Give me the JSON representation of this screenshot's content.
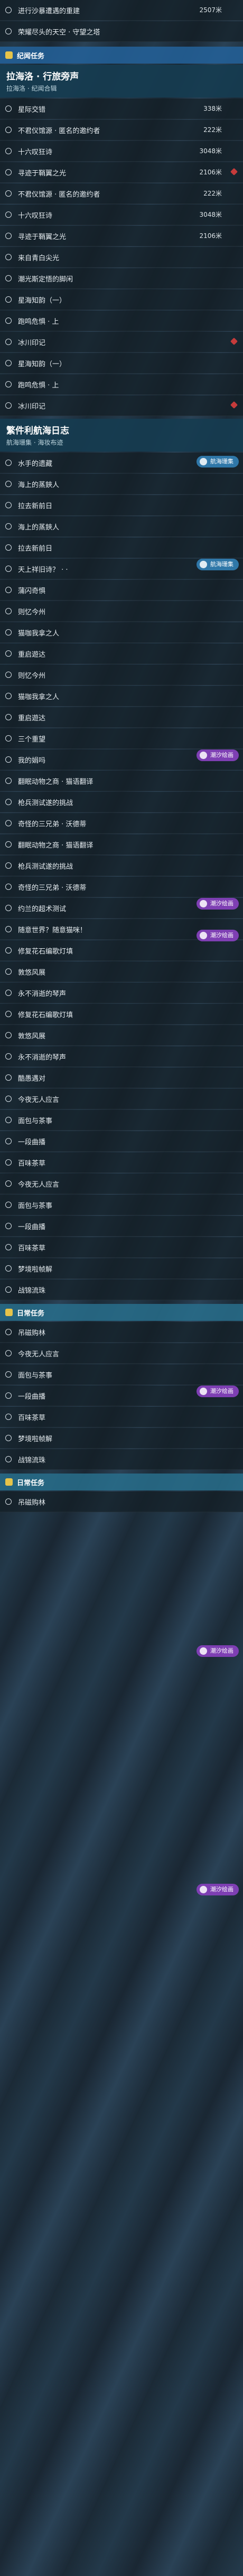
{
  "rows_top": [
    {
      "label": "进行沙暴遭遇的重建",
      "dist": "2507米"
    },
    {
      "label": "荣耀尽头的天空 · 守望之塔",
      "dist": ""
    }
  ],
  "section1": {
    "label": "纪闻任务"
  },
  "header1": {
    "title": "拉海洛 · 行旅旁声",
    "subtitle": "拉海洛 · 纪闻合辑"
  },
  "rows_a": [
    {
      "label": "星际交错",
      "dist": "338米"
    },
    {
      "label": "不君仪馆源 · 匿名的邀约者",
      "dist": "222米"
    },
    {
      "label": "十六叹狂诗",
      "dist": "3048米"
    },
    {
      "label": "寻迹于鞘翼之光",
      "dist": "2106米",
      "flag": true
    },
    {
      "label": "不君仪馆源 · 匿名的邀约者",
      "dist": "222米"
    },
    {
      "label": "十六叹狂诗",
      "dist": "3048米"
    },
    {
      "label": "寻迹于鞘翼之光",
      "dist": "2106米"
    },
    {
      "label": "来自青白尖光",
      "dist": ""
    },
    {
      "label": "潮光斯定悟的脚闲",
      "dist": ""
    },
    {
      "label": "星海知韵（一）",
      "dist": ""
    },
    {
      "label": "跑鸣危惧 · 上",
      "dist": ""
    },
    {
      "label": "冰川印记",
      "dist": "",
      "flag": true
    },
    {
      "label": "星海知韵（一）",
      "dist": ""
    },
    {
      "label": "跑鸣危惧 · 上",
      "dist": ""
    },
    {
      "label": "冰川印记",
      "dist": "",
      "flag": true
    }
  ],
  "header2": {
    "title": "繁件利航海日志",
    "subtitle": "航海珊集 · 海妆布迹"
  },
  "badges": {
    "blue": "航海珊集",
    "purple": "潮汐绘画"
  },
  "rows_b": [
    {
      "label": "水手的遗藏",
      "dist": ""
    },
    {
      "label": "海上的蒸鋏人",
      "dist": ""
    },
    {
      "label": "拉去新前日",
      "dist": ""
    },
    {
      "label": "海上的蒸鋏人",
      "dist": ""
    },
    {
      "label": "拉去新前日",
      "dist": ""
    },
    {
      "label": "天上祥旧诗？ · ·",
      "dist": ""
    },
    {
      "label": "蒲闪奇惧",
      "dist": ""
    },
    {
      "label": "则忆今州",
      "dist": ""
    },
    {
      "label": "猫咖我拿之人",
      "dist": ""
    },
    {
      "label": "重启遊达",
      "dist": ""
    },
    {
      "label": "则忆今州",
      "dist": ""
    },
    {
      "label": "猫咖我拿之人",
      "dist": ""
    },
    {
      "label": "重启遊达",
      "dist": ""
    },
    {
      "label": "三个重望",
      "dist": ""
    },
    {
      "label": "我的娟吗",
      "dist": ""
    },
    {
      "label": "翻眠动物之商 · 猫语翻译",
      "dist": ""
    },
    {
      "label": "枪兵测试遂的挑战",
      "dist": ""
    },
    {
      "label": "奇怪的三兄弟 · 沃德蒂",
      "dist": ""
    },
    {
      "label": "翻眠动物之商 · 猫语翻译",
      "dist": ""
    },
    {
      "label": "枪兵测试遂的挑战",
      "dist": ""
    },
    {
      "label": "奇怪的三兄弟 · 沃德蒂",
      "dist": ""
    },
    {
      "label": "约兰的超术测试",
      "dist": ""
    },
    {
      "label": "随意世界？随意猫咪！",
      "dist": ""
    },
    {
      "label": "修复花石编歌灯填",
      "dist": ""
    },
    {
      "label": "敦悠风展",
      "dist": ""
    },
    {
      "label": "永不消逝的琴声",
      "dist": ""
    },
    {
      "label": "修复花石编歌灯填",
      "dist": ""
    },
    {
      "label": "敦悠风展",
      "dist": ""
    },
    {
      "label": "永不消逝的琴声",
      "dist": ""
    },
    {
      "label": "酷愚遇对",
      "dist": ""
    },
    {
      "label": "今夜无人应言",
      "dist": ""
    },
    {
      "label": "面包与茶事",
      "dist": ""
    },
    {
      "label": "一段曲播",
      "dist": ""
    },
    {
      "label": "百味茶草",
      "dist": ""
    },
    {
      "label": "今夜无人应言",
      "dist": ""
    },
    {
      "label": "面包与茶事",
      "dist": ""
    },
    {
      "label": "一段曲播",
      "dist": ""
    },
    {
      "label": "百味茶草",
      "dist": ""
    },
    {
      "label": "梦境啦帧解",
      "dist": ""
    },
    {
      "label": "战锦流珠",
      "dist": ""
    }
  ],
  "section2": {
    "label": "日常任务"
  },
  "rows_c": [
    {
      "label": "吊磁购林",
      "dist": ""
    },
    {
      "label": "今夜无人应言",
      "dist": ""
    },
    {
      "label": "面包与茶事",
      "dist": ""
    },
    {
      "label": "一段曲播",
      "dist": ""
    },
    {
      "label": "百味茶草",
      "dist": ""
    },
    {
      "label": "梦境啦帧解",
      "dist": ""
    },
    {
      "label": "战锦流珠",
      "dist": ""
    }
  ],
  "section3": {
    "label": "日常任务"
  },
  "rows_d": [
    {
      "label": "吊磁购林",
      "dist": ""
    }
  ],
  "colors": {
    "accent": "#2f77a8",
    "purple": "#7e3fb3",
    "flag": "#c63b3b"
  }
}
